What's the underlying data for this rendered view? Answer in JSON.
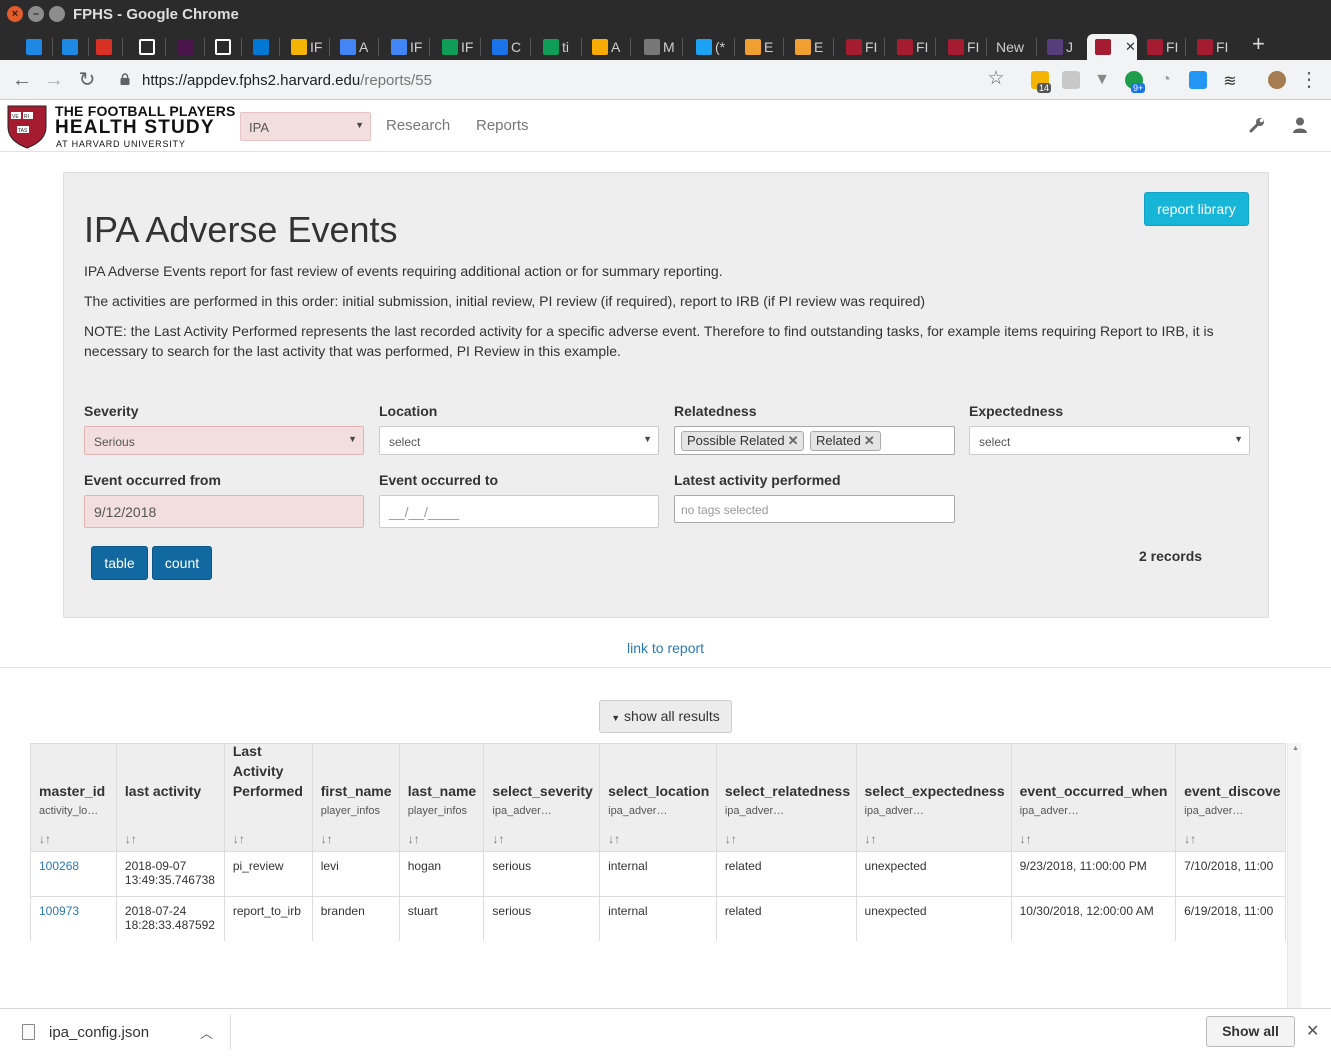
{
  "window": {
    "title": "FPHS - Google Chrome"
  },
  "tabs": [
    {
      "label": "",
      "icon": "outlook-check-icon",
      "color": "#1e88e5"
    },
    {
      "label": "",
      "icon": "outlook-check-icon",
      "color": "#1e88e5"
    },
    {
      "label": "",
      "icon": "gmail-icon",
      "color": "#d93025"
    },
    {
      "label": "",
      "icon": "trello-icon",
      "color": "#ffffff"
    },
    {
      "label": "",
      "icon": "slack-icon",
      "color": "#4a154b"
    },
    {
      "label": "",
      "icon": "trello-icon",
      "color": "#ffffff"
    },
    {
      "label": "",
      "icon": "outlook-icon",
      "color": "#0078d4"
    },
    {
      "label": "IF",
      "icon": "drive-icon",
      "color": "#f4b400"
    },
    {
      "label": "A",
      "icon": "docs-icon",
      "color": "#4285f4"
    },
    {
      "label": "IF",
      "icon": "docs-icon",
      "color": "#4285f4"
    },
    {
      "label": "IF",
      "icon": "sheets-icon",
      "color": "#0f9d58"
    },
    {
      "label": "C",
      "icon": "calendar-icon",
      "color": "#1a73e8"
    },
    {
      "label": "ti",
      "icon": "sheets-icon",
      "color": "#0f9d58"
    },
    {
      "label": "A",
      "icon": "analytics-icon",
      "color": "#f9ab00"
    },
    {
      "label": "M",
      "icon": "triangle-icon",
      "color": "#777777"
    },
    {
      "label": "(*",
      "icon": "twitter-icon",
      "color": "#1da1f2"
    },
    {
      "label": "E",
      "icon": "box-icon",
      "color": "#f0a030"
    },
    {
      "label": "E",
      "icon": "box-icon",
      "color": "#f0a030"
    },
    {
      "label": "FI",
      "icon": "harvard-icon",
      "color": "#a51c30"
    },
    {
      "label": "FI",
      "icon": "harvard-icon",
      "color": "#a51c30"
    },
    {
      "label": "FI",
      "icon": "harvard-icon",
      "color": "#a51c30"
    },
    {
      "label": "New",
      "icon": "",
      "color": ""
    },
    {
      "label": "J",
      "icon": "bootstrap-icon",
      "color": "#563d7c"
    },
    {
      "label": "",
      "icon": "harvard-icon",
      "color": "#a51c30",
      "active": true
    },
    {
      "label": "FI",
      "icon": "harvard-icon",
      "color": "#a51c30"
    },
    {
      "label": "FI",
      "icon": "harvard-icon",
      "color": "#a51c30"
    }
  ],
  "toolbar": {
    "url_host": "https://appdev.fphs2.harvard.edu",
    "url_path": "/reports/55",
    "ext_badge_1": "14",
    "ext_badge_2": "9+"
  },
  "app": {
    "logo_line1": "THE FOOTBALL PLAYERS",
    "logo_line2": "HEALTH STUDY",
    "logo_line3": "AT HARVARD UNIVERSITY",
    "logo_shield_text": [
      "VE",
      "RI",
      "TAS"
    ],
    "app_select": "IPA",
    "nav": [
      "Research",
      "Reports"
    ]
  },
  "report": {
    "library_button": "report library",
    "title": "IPA Adverse Events",
    "desc1": "IPA Adverse Events report for fast review of events requiring additional action or for summary reporting.",
    "desc2": "The activities are performed in this order: initial submission, initial review, PI review (if required), report to IRB (if PI review was required)",
    "desc3": "NOTE: the Last Activity Performed represents the last recorded activity for a specific adverse event. Therefore to find outstanding tasks, for example items requiring Report to IRB, it is necessary to search for the last activity that was performed, PI Review in this example.",
    "filters": {
      "severity_label": "Severity",
      "severity_value": "Serious",
      "location_label": "Location",
      "location_value": "select",
      "relatedness_label": "Relatedness",
      "relatedness_tags": [
        "Possible Related",
        "Related"
      ],
      "expectedness_label": "Expectedness",
      "expectedness_value": "select",
      "from_label": "Event occurred from",
      "from_value": "9/12/2018",
      "to_label": "Event occurred to",
      "to_placeholder": "__/__/____",
      "latest_label": "Latest activity performed",
      "latest_placeholder": "no tags selected"
    },
    "btn_table": "table",
    "btn_count": "count",
    "records": "2 records",
    "link": "link to report",
    "show_all": "show all results"
  },
  "table": {
    "columns": [
      {
        "name": "master_id",
        "sub": "activity_lo…",
        "sort": "↓↑"
      },
      {
        "name": "last activity",
        "sub": "",
        "sort": "↓↑"
      },
      {
        "name": "Last Activity Performed",
        "sub": "",
        "sort": "↓↑"
      },
      {
        "name": "first_name",
        "sub": "player_infos",
        "sort": "↓↑"
      },
      {
        "name": "last_name",
        "sub": "player_infos",
        "sort": "↓↑"
      },
      {
        "name": "select_severity",
        "sub": "ipa_adver…",
        "sort": "↓↑"
      },
      {
        "name": "select_location",
        "sub": "ipa_adver…",
        "sort": "↓↑"
      },
      {
        "name": "select_relatedness",
        "sub": "ipa_adver…",
        "sort": "↓↑"
      },
      {
        "name": "select_expectedness",
        "sub": "ipa_adver…",
        "sort": "↓↑"
      },
      {
        "name": "event_occurred_when",
        "sub": "ipa_adver…",
        "sort": "↓↑"
      },
      {
        "name": "event_discove",
        "sub": "ipa_adver…",
        "sort": "↓↑"
      }
    ],
    "rows": [
      [
        "100268",
        "2018-09-07 13:49:35.746738",
        "pi_review",
        "levi",
        "hogan",
        "serious",
        "internal",
        "related",
        "unexpected",
        "9/23/2018, 11:00:00 PM",
        "7/10/2018, 11:00"
      ],
      [
        "100973",
        "2018-07-24 18:28:33.487592",
        "report_to_irb",
        "branden",
        "stuart",
        "serious",
        "internal",
        "related",
        "unexpected",
        "10/30/2018, 12:00:00 AM",
        "6/19/2018, 11:00"
      ]
    ]
  },
  "download": {
    "file": "ipa_config.json",
    "show_all": "Show all"
  }
}
